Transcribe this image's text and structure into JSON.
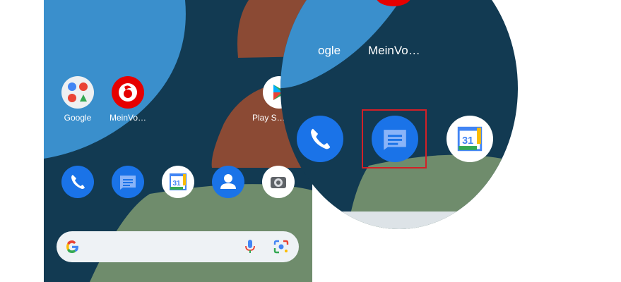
{
  "home": {
    "apps": [
      {
        "label": "Google",
        "icon": "google-folder-icon"
      },
      {
        "label": "MeinVo…",
        "icon": "vodafone-icon"
      },
      {
        "label": "Play S…",
        "icon": "play-store-icon"
      }
    ],
    "dock": [
      {
        "icon": "phone-icon"
      },
      {
        "icon": "messages-icon"
      },
      {
        "icon": "calendar-icon",
        "text": "31"
      },
      {
        "icon": "contacts-icon"
      },
      {
        "icon": "camera-icon"
      }
    ],
    "search": {
      "icons": [
        "google-g-icon",
        "microphone-icon",
        "google-lens-icon"
      ]
    }
  },
  "zoom": {
    "labels": [
      "ogle",
      "MeinVo…"
    ],
    "icons": [
      {
        "icon": "phone-icon"
      },
      {
        "icon": "messages-icon"
      },
      {
        "icon": "calendar-icon",
        "text": "31"
      }
    ],
    "highlighted": "messages-icon"
  },
  "colors": {
    "wallpaper_dark": "#123a52",
    "wallpaper_blue": "#3a8fcc",
    "wallpaper_brown": "#8b4a34",
    "wallpaper_green": "#6f8c6c",
    "icon_blue": "#1a73e8",
    "highlight_red": "#d32027"
  }
}
